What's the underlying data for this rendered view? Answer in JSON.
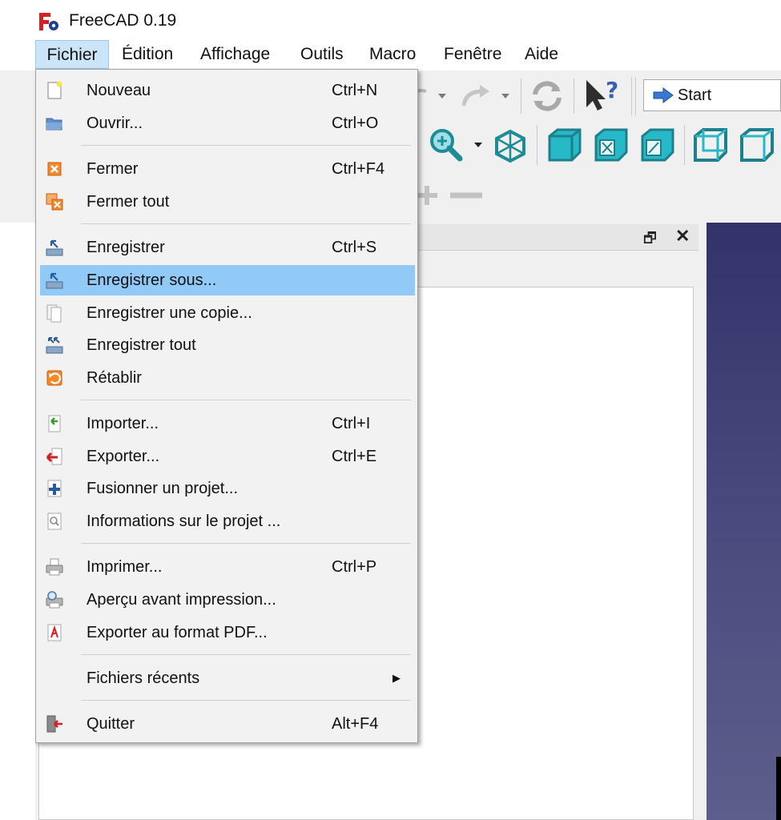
{
  "window": {
    "title": "FreeCAD 0.19"
  },
  "menubar": {
    "items": [
      {
        "label": "Fichier"
      },
      {
        "label": "Édition"
      },
      {
        "label": "Affichage"
      },
      {
        "label": "Outils"
      },
      {
        "label": "Macro"
      },
      {
        "label": "Fenêtre"
      },
      {
        "label": "Aide"
      }
    ]
  },
  "toolbar": {
    "workbench_label": "Start"
  },
  "file_menu": {
    "items": [
      {
        "label": "Nouveau",
        "shortcut": "Ctrl+N",
        "icon": "new-document-icon"
      },
      {
        "label": "Ouvrir...",
        "shortcut": "Ctrl+O",
        "icon": "open-folder-icon"
      },
      {
        "label": "Fermer",
        "shortcut": "Ctrl+F4",
        "icon": "close-document-icon"
      },
      {
        "label": "Fermer tout",
        "shortcut": "",
        "icon": "close-all-icon"
      },
      {
        "label": "Enregistrer",
        "shortcut": "Ctrl+S",
        "icon": "save-icon"
      },
      {
        "label": "Enregistrer sous...",
        "shortcut": "",
        "icon": "save-as-icon",
        "highlighted": true
      },
      {
        "label": "Enregistrer une copie...",
        "shortcut": "",
        "icon": "save-copy-icon"
      },
      {
        "label": "Enregistrer tout",
        "shortcut": "",
        "icon": "save-all-icon"
      },
      {
        "label": "Rétablir",
        "shortcut": "",
        "icon": "revert-icon"
      },
      {
        "label": "Importer...",
        "shortcut": "Ctrl+I",
        "icon": "import-icon"
      },
      {
        "label": "Exporter...",
        "shortcut": "Ctrl+E",
        "icon": "export-icon"
      },
      {
        "label": "Fusionner un projet...",
        "shortcut": "",
        "icon": "merge-project-icon"
      },
      {
        "label": "Informations sur le projet ...",
        "shortcut": "",
        "icon": "project-info-icon"
      },
      {
        "label": "Imprimer...",
        "shortcut": "Ctrl+P",
        "icon": "print-icon"
      },
      {
        "label": "Aperçu avant impression...",
        "shortcut": "",
        "icon": "print-preview-icon"
      },
      {
        "label": "Exporter au format PDF...",
        "shortcut": "",
        "icon": "pdf-icon"
      },
      {
        "label": "Fichiers récents",
        "shortcut": "",
        "icon": "",
        "submenu": true
      },
      {
        "label": "Quitter",
        "shortcut": "Alt+F4",
        "icon": "quit-icon"
      }
    ]
  },
  "colors": {
    "menu_highlight": "#91c9f7",
    "menubar_active": "#cce4f7",
    "view_background": "#3a3a72",
    "view_icon_teal": "#2ab7c6"
  }
}
